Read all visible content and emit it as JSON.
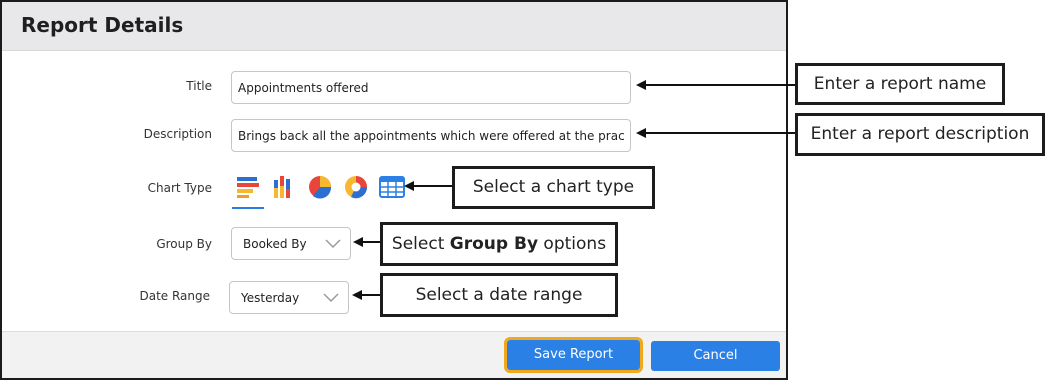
{
  "dialog": {
    "title": "Report Details",
    "fields": {
      "title_label": "Title",
      "title_value": "Appointments offered",
      "description_label": "Description",
      "description_value": "Brings back all the appointments which were offered at the prac",
      "chart_type_label": "Chart Type",
      "group_by_label": "Group By",
      "group_by_value": "Booked By",
      "date_range_label": "Date Range",
      "date_range_value": "Yesterday"
    },
    "chart_types": [
      "bar-chart-icon",
      "stacked-column-icon",
      "pie-chart-icon",
      "donut-chart-icon",
      "table-grid-icon"
    ],
    "selected_chart_type": "bar-chart-icon",
    "buttons": {
      "save": "Save Report",
      "cancel": "Cancel"
    }
  },
  "callouts": {
    "report_name": "Enter a report name",
    "report_description": "Enter a report description",
    "chart_type": "Select a chart type",
    "group_by_prefix": "Select ",
    "group_by_bold": "Group By",
    "group_by_suffix": " options",
    "date_range": "Select a date range"
  },
  "colors": {
    "accent": "#2b80e6",
    "highlight": "#f2a81d",
    "header_bg": "#e8e8ea"
  }
}
